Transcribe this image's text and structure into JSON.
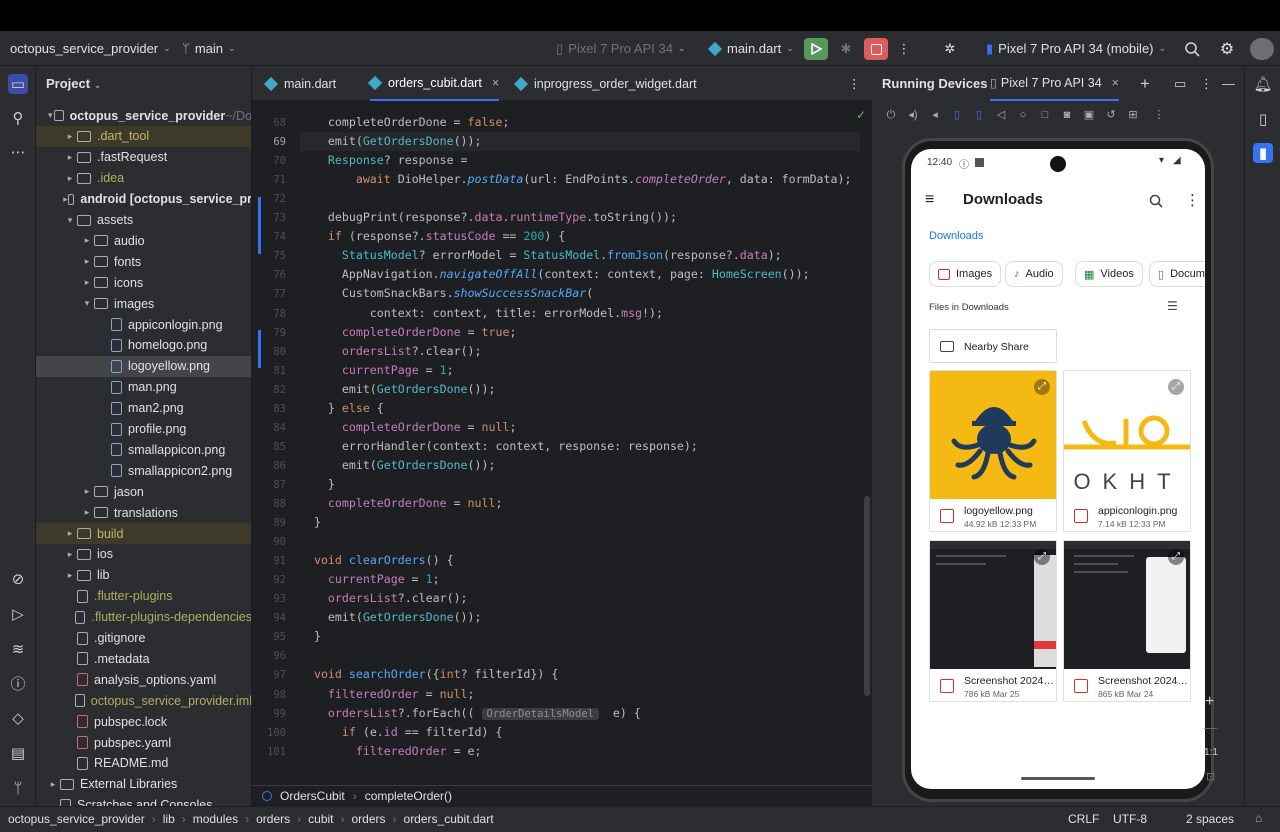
{
  "toolbar": {
    "project_name": "octopus_service_provider",
    "branch": "main",
    "device_target": "Pixel 7 Pro API 34",
    "run_config": "main.dart",
    "running_device": "Pixel 7 Pro API 34 (mobile)"
  },
  "project_panel": {
    "title": "Project",
    "tree": [
      {
        "label": "octopus_service_provider",
        "suffix": "~/Do",
        "indent": 0,
        "kind": "folder",
        "arrow": "▾",
        "bold": true
      },
      {
        "label": ".dart_tool",
        "indent": 1,
        "kind": "folder",
        "arrow": "▸",
        "style": "muted",
        "highlight": true
      },
      {
        "label": ".fastRequest",
        "indent": 1,
        "kind": "folder",
        "arrow": "▸"
      },
      {
        "label": ".idea",
        "indent": 1,
        "kind": "folder",
        "arrow": "▸",
        "style": "yellow"
      },
      {
        "label": "android [octopus_service_pr",
        "indent": 1,
        "kind": "folder",
        "arrow": "▸",
        "bold": true
      },
      {
        "label": "assets",
        "indent": 1,
        "kind": "folder",
        "arrow": "▾"
      },
      {
        "label": "audio",
        "indent": 2,
        "kind": "folder",
        "arrow": "▸"
      },
      {
        "label": "fonts",
        "indent": 2,
        "kind": "folder",
        "arrow": "▸"
      },
      {
        "label": "icons",
        "indent": 2,
        "kind": "folder",
        "arrow": "▸"
      },
      {
        "label": "images",
        "indent": 2,
        "kind": "folder",
        "arrow": "▾"
      },
      {
        "label": "appiconlogin.png",
        "indent": 3,
        "kind": "img"
      },
      {
        "label": "homelogo.png",
        "indent": 3,
        "kind": "img"
      },
      {
        "label": "logoyellow.png",
        "indent": 3,
        "kind": "img",
        "selected": true
      },
      {
        "label": "man.png",
        "indent": 3,
        "kind": "img"
      },
      {
        "label": "man2.png",
        "indent": 3,
        "kind": "img"
      },
      {
        "label": "profile.png",
        "indent": 3,
        "kind": "img"
      },
      {
        "label": "smallappicon.png",
        "indent": 3,
        "kind": "img"
      },
      {
        "label": "smallappicon2.png",
        "indent": 3,
        "kind": "img"
      },
      {
        "label": "jason",
        "indent": 2,
        "kind": "folder",
        "arrow": "▸"
      },
      {
        "label": "translations",
        "indent": 2,
        "kind": "folder",
        "arrow": "▸"
      },
      {
        "label": "build",
        "indent": 1,
        "kind": "folder",
        "arrow": "▸",
        "style": "muted",
        "highlight": true
      },
      {
        "label": "ios",
        "indent": 1,
        "kind": "folder",
        "arrow": "▸"
      },
      {
        "label": "lib",
        "indent": 1,
        "kind": "folder",
        "arrow": "▸"
      },
      {
        "label": ".flutter-plugins",
        "indent": 1,
        "kind": "plain",
        "style": "yellow"
      },
      {
        "label": ".flutter-plugins-dependencies",
        "indent": 1,
        "kind": "plain",
        "style": "yellow"
      },
      {
        "label": ".gitignore",
        "indent": 1,
        "kind": "plain"
      },
      {
        "label": ".metadata",
        "indent": 1,
        "kind": "plain"
      },
      {
        "label": "analysis_options.yaml",
        "indent": 1,
        "kind": "yaml"
      },
      {
        "label": "octopus_service_provider.iml",
        "indent": 1,
        "kind": "plain",
        "style": "yellow"
      },
      {
        "label": "pubspec.lock",
        "indent": 1,
        "kind": "yaml"
      },
      {
        "label": "pubspec.yaml",
        "indent": 1,
        "kind": "yaml"
      },
      {
        "label": "README.md",
        "indent": 1,
        "kind": "plain"
      },
      {
        "label": "External Libraries",
        "indent": 0,
        "kind": "folder",
        "arrow": "▸"
      },
      {
        "label": "Scratches and Consoles",
        "indent": 0,
        "kind": "plain"
      }
    ]
  },
  "editor": {
    "tabs": [
      "main.dart",
      "orders_cubit.dart",
      "inprogress_order_widget.dart"
    ],
    "active_tab": 1,
    "current_line": 69,
    "lines": [
      {
        "n": 68,
        "h": "    <span class='kw'></span>completeOrderDone = <span class='kw'>false</span>;"
      },
      {
        "n": 69,
        "h": "    emit(<span class='ty'>GetOrdersDone</span>());"
      },
      {
        "n": 70,
        "h": "    <span class='ty'>Response</span>? response ="
      },
      {
        "n": 71,
        "h": "        <span class='kw'>await</span> DioHelper.<span class='it'>postData</span>(url: EndPoints.<span class='pr'><i>completeOrder</i></span>, data: formData);"
      },
      {
        "n": 72,
        "h": ""
      },
      {
        "n": 73,
        "h": "    debugPrint(response?.<span class='pr'>data</span>.<span class='pr'>runtimeType</span>.toString());"
      },
      {
        "n": 74,
        "h": "    <span class='kw'>if</span> (response?.<span class='pr'>statusCode</span> == <span class='num'>200</span>) {"
      },
      {
        "n": 75,
        "h": "      <span class='ty'>StatusModel</span>? errorModel = <span class='ty'>StatusModel</span>.<span class='fn'>fromJson</span>(response?.<span class='pr'>data</span>);"
      },
      {
        "n": 76,
        "h": "      AppNavigation.<span class='it'>navigateOffAll</span>(context: context, page: <span class='ty'>HomeScreen</span>());"
      },
      {
        "n": 77,
        "h": "      CustomSnackBars.<span class='it'>showSuccessSnackBar</span>("
      },
      {
        "n": 78,
        "h": "          context: context, title: errorModel.<span class='pr'>msg</span>!);"
      },
      {
        "n": 79,
        "h": "      <span class='pr'>completeOrderDone</span> = <span class='kw'>true</span>;"
      },
      {
        "n": 80,
        "h": "      <span class='pr'>ordersList</span>?.clear();"
      },
      {
        "n": 81,
        "h": "      <span class='pr'>currentPage</span> = <span class='num'>1</span>;"
      },
      {
        "n": 82,
        "h": "      emit(<span class='ty'>GetOrdersDone</span>());"
      },
      {
        "n": 83,
        "h": "    } <span class='kw'>else</span> {"
      },
      {
        "n": 84,
        "h": "      <span class='pr'>completeOrderDone</span> = <span class='kw'>null</span>;"
      },
      {
        "n": 85,
        "h": "      errorHandler(context: context, response: response);"
      },
      {
        "n": 86,
        "h": "      emit(<span class='ty'>GetOrdersDone</span>());"
      },
      {
        "n": 87,
        "h": "    }"
      },
      {
        "n": 88,
        "h": "    <span class='pr'>completeOrderDone</span> = <span class='kw'>null</span>;"
      },
      {
        "n": 89,
        "h": "  }"
      },
      {
        "n": 90,
        "h": ""
      },
      {
        "n": 91,
        "h": "  <span class='kw'>void</span> <span class='fn'>clearOrders</span>() {"
      },
      {
        "n": 92,
        "h": "    <span class='pr'>currentPage</span> = <span class='num'>1</span>;"
      },
      {
        "n": 93,
        "h": "    <span class='pr'>ordersList</span>?.clear();"
      },
      {
        "n": 94,
        "h": "    emit(<span class='ty'>GetOrdersDone</span>());"
      },
      {
        "n": 95,
        "h": "  }"
      },
      {
        "n": 96,
        "h": ""
      },
      {
        "n": 97,
        "h": "  <span class='kw'>void</span> <span class='fn'>searchOrder</span>({<span class='kw'>int</span>? filterId}) {"
      },
      {
        "n": 98,
        "h": "    <span class='pr'>filteredOrder</span> = <span class='kw'>null</span>;"
      },
      {
        "n": 99,
        "h": "    <span class='pr'>ordersList</span>?.forEach(( <span class='hint'>OrderDetailsModel</span>  e) {"
      },
      {
        "n": 100,
        "h": "      <span class='kw'>if</span> (e.<span class='pr'>id</span> == filterId) {"
      },
      {
        "n": 101,
        "h": "        <span class='pr'>filteredOrder</span> = e;"
      }
    ],
    "breadcrumb": [
      "OrdersCubit",
      "completeOrder()"
    ]
  },
  "devices_panel": {
    "title": "Running Devices",
    "tab": "Pixel 7 Pro API 34"
  },
  "phone": {
    "time": "12:40",
    "app_title": "Downloads",
    "breadcrumb": "Downloads",
    "chips": [
      "Images",
      "Audio",
      "Videos",
      "Docum"
    ],
    "section_label": "Files in Downloads",
    "folder_card": "Nearby Share",
    "files": [
      {
        "name": "logoyellow.png",
        "meta": "44.92 kB 12:33 PM"
      },
      {
        "name": "appiconlogin.png",
        "meta": "7.14 kB 12:33 PM"
      },
      {
        "name": "Screenshot 2024…",
        "meta": "786 kB Mar 25"
      },
      {
        "name": "Screenshot 2024…",
        "meta": "865 kB Mar 24"
      }
    ],
    "thumb_text": "OKHT"
  },
  "statusbar": {
    "path": [
      "octopus_service_provider",
      "lib",
      "modules",
      "orders",
      "cubit",
      "orders",
      "orders_cubit.dart"
    ],
    "line_sep": "CRLF",
    "encoding": "UTF-8",
    "indent": "2 spaces"
  }
}
